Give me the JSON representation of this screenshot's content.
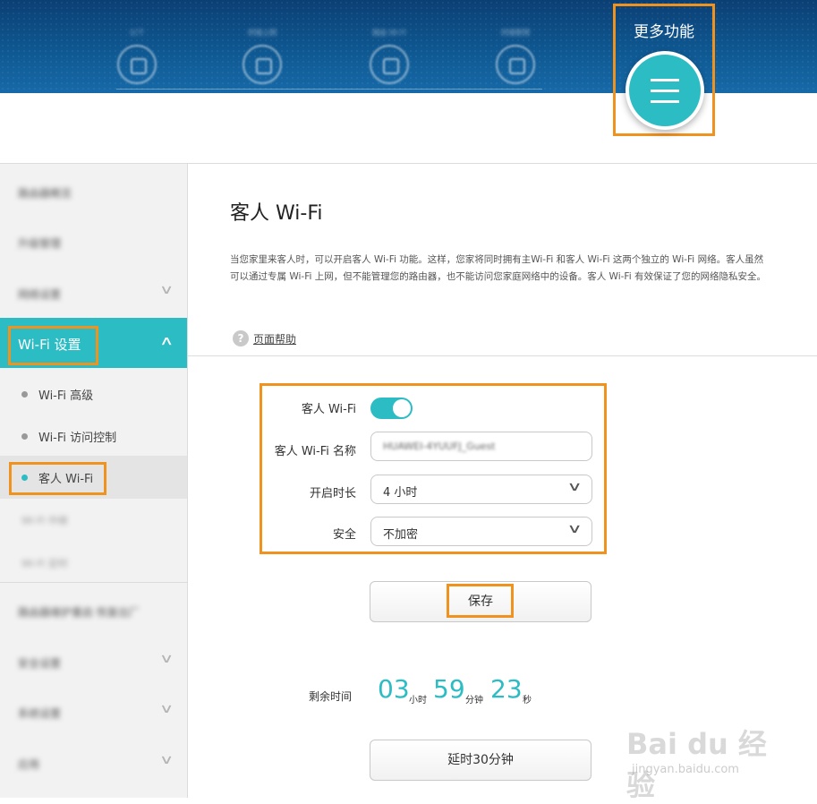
{
  "header": {
    "nav_items": [
      {
        "label": "以下",
        "icon": "download-icon"
      },
      {
        "label": "终端上网",
        "icon": "device-icon"
      },
      {
        "label": "路由 Wi-Fi",
        "icon": "wifi-icon"
      },
      {
        "label": "终端管理",
        "icon": "user-icon"
      }
    ],
    "more_label": "更多功能",
    "more_icon": "menu-icon"
  },
  "sidebar": {
    "top_items": [
      "路由器概览",
      "升级管理",
      "网络设置"
    ],
    "active_section": "Wi-Fi 设置",
    "sub_items": [
      {
        "label": "Wi-Fi 高级",
        "selected": false
      },
      {
        "label": "Wi-Fi 访问控制",
        "selected": false
      },
      {
        "label": "客人 Wi-Fi",
        "selected": true
      }
    ],
    "blurred_sub_items": [
      "Wi-Fi 中继",
      "Wi-Fi 定时"
    ],
    "bottom_items": [
      "路由器维护重启 恢复出厂",
      "安全设置",
      "系统设置",
      "应用"
    ]
  },
  "main": {
    "title": "客人 Wi-Fi",
    "description": "当您家里来客人时，可以开启客人 Wi-Fi 功能。这样，您家将同时拥有主Wi-Fi 和客人 Wi-Fi 这两个独立的 Wi-Fi 网络。客人虽然可以通过专属 Wi-Fi 上网，但不能管理您的路由器，也不能访问您家庭网络中的设备。客人 Wi-Fi 有效保证了您的网络隐私安全。",
    "help_text": "页面帮助",
    "form": {
      "guest_wifi_label": "客人 Wi-Fi",
      "guest_wifi_enabled": true,
      "name_label": "客人 Wi-Fi 名称",
      "name_value": "HUAWEI-4YUUFJ_Guest",
      "duration_label": "开启时长",
      "duration_value": "4 小时",
      "security_label": "安全",
      "security_value": "不加密"
    },
    "save_label": "保存",
    "remaining_label": "剩余时间",
    "countdown": {
      "hours": "03",
      "hours_unit": "小时",
      "minutes": "59",
      "minutes_unit": "分钟",
      "seconds": "23",
      "seconds_unit": "秒"
    },
    "extend_label": "延时30分钟"
  },
  "watermark": {
    "main": "Bai du 经验",
    "sub": "jingyan.baidu.com"
  },
  "colors": {
    "accent": "#2cbcc4",
    "highlight": "#f0921e",
    "banner": "#0f5a94"
  }
}
